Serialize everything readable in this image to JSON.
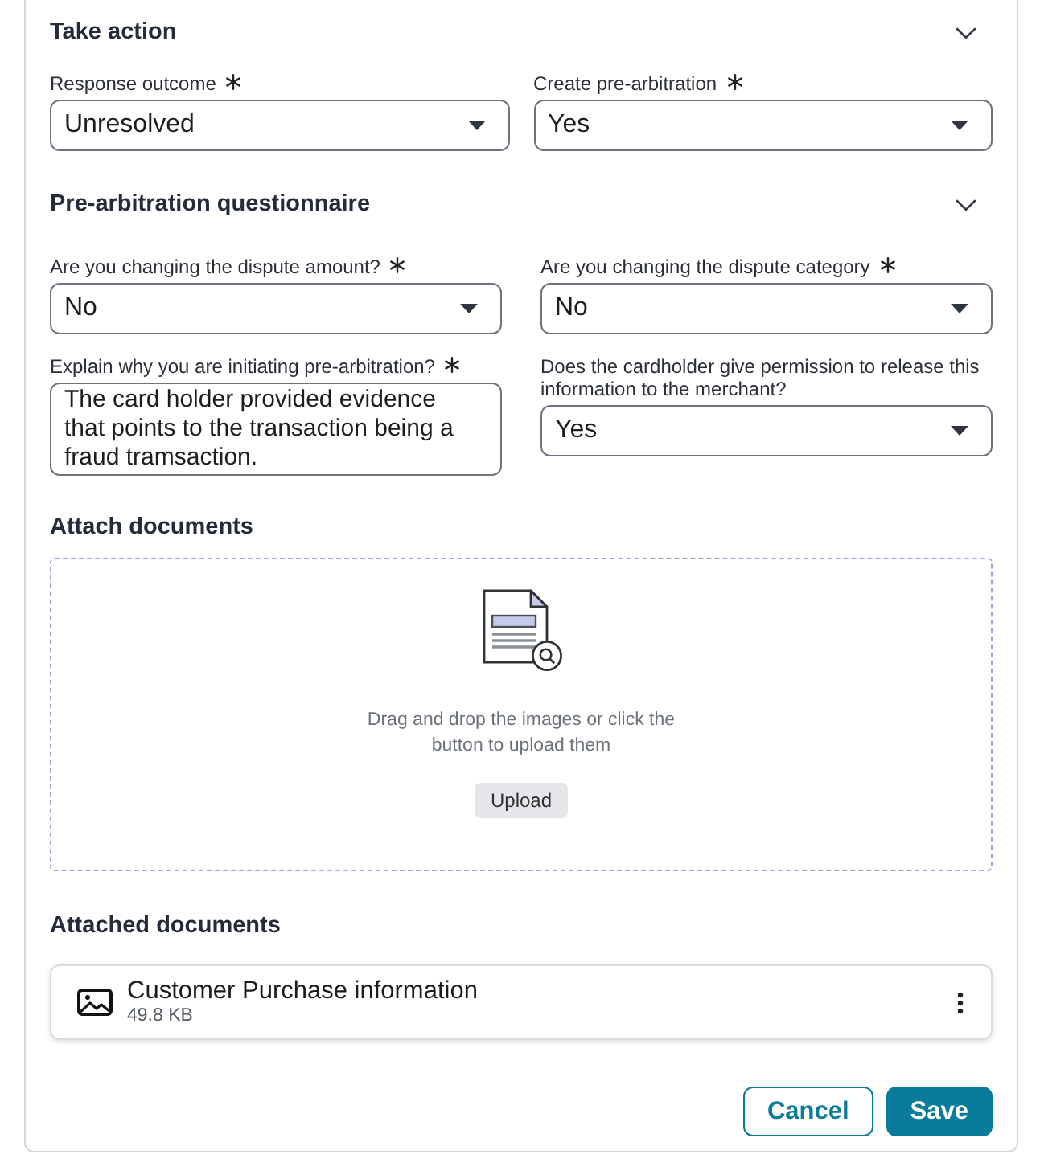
{
  "sections": [
    {
      "title": "Take action",
      "collapsible": true,
      "fields": [
        {
          "kind": "select",
          "label": "Response outcome",
          "required": true,
          "value": "Unresolved"
        },
        {
          "kind": "select",
          "label": "Create pre-arbitration",
          "required": true,
          "value": "Yes"
        }
      ]
    },
    {
      "title": "Pre-arbitration questionnaire",
      "collapsible": true,
      "fields": [
        {
          "kind": "select",
          "label": "Are you changing the dispute amount?",
          "required": true,
          "value": "No"
        },
        {
          "kind": "select",
          "label": "Are you changing the dispute category",
          "required": true,
          "value": "No"
        },
        {
          "kind": "textarea",
          "label": "Explain why you are initiating pre-arbitration?",
          "required": true,
          "value": "The card holder provided evidence that points to the transaction being a fraud tramsaction."
        },
        {
          "kind": "select",
          "label": "Does the cardholder give permission to release this information to the merchant?",
          "required": false,
          "value": "Yes"
        }
      ]
    }
  ],
  "upload": {
    "title": "Attach documents",
    "hint": "Drag and drop the images or click the button to upload them",
    "button": "Upload"
  },
  "attached": {
    "title": "Attached documents",
    "files": [
      {
        "name": "Customer Purchase information",
        "size": "49.8 KB"
      }
    ]
  },
  "actions": [
    {
      "label": "Cancel",
      "kind": "secondary"
    },
    {
      "label": "Save",
      "kind": "primary"
    }
  ]
}
